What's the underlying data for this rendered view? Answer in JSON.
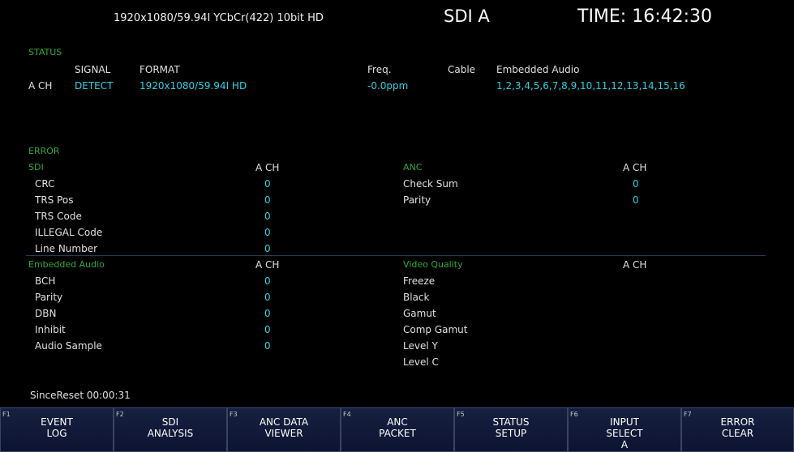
{
  "header": {
    "format": "1920x1080/59.94I YCbCr(422) 10bit HD",
    "input": "SDI A",
    "time": "TIME: 16:42:30"
  },
  "status": {
    "title": "STATUS",
    "col_signal": "SIGNAL",
    "col_format": "FORMAT",
    "col_freq": "Freq.",
    "col_cable": "Cable",
    "col_audio": "Embedded Audio",
    "row_label": "A CH",
    "signal": "DETECT",
    "format": "1920x1080/59.94I HD",
    "freq": "-0.0ppm",
    "audio": "1,2,3,4,5,6,7,8,9,10,11,12,13,14,15,16"
  },
  "error": {
    "title": "ERROR",
    "sdi": {
      "title": "SDI",
      "ch": "A CH",
      "rows": [
        {
          "label": "CRC",
          "value": "0"
        },
        {
          "label": "TRS Pos",
          "value": "0"
        },
        {
          "label": "TRS Code",
          "value": "0"
        },
        {
          "label": "ILLEGAL Code",
          "value": "0"
        },
        {
          "label": "Line Number",
          "value": "0"
        }
      ]
    },
    "anc": {
      "title": "ANC",
      "ch": "A CH",
      "rows": [
        {
          "label": "Check Sum",
          "value": "0"
        },
        {
          "label": "Parity",
          "value": "0"
        }
      ]
    },
    "audio": {
      "title": "Embedded Audio",
      "ch": "A CH",
      "rows": [
        {
          "label": "BCH",
          "value": "0"
        },
        {
          "label": "Parity",
          "value": "0"
        },
        {
          "label": "DBN",
          "value": "0"
        },
        {
          "label": "Inhibit",
          "value": "0"
        },
        {
          "label": "Audio Sample",
          "value": "0"
        }
      ]
    },
    "video": {
      "title": "Video Quality",
      "ch": "A CH",
      "rows": [
        {
          "label": "Freeze"
        },
        {
          "label": "Black"
        },
        {
          "label": "Gamut"
        },
        {
          "label": "Comp Gamut"
        },
        {
          "label": "Level Y"
        },
        {
          "label": "Level C"
        }
      ]
    }
  },
  "since_reset": "SinceReset 00:00:31",
  "fkeys": [
    {
      "num": "F1",
      "line1": "EVENT",
      "line2": "LOG",
      "line3": ""
    },
    {
      "num": "F2",
      "line1": "SDI",
      "line2": "ANALYSIS",
      "line3": ""
    },
    {
      "num": "F3",
      "line1": "ANC DATA",
      "line2": "VIEWER",
      "line3": ""
    },
    {
      "num": "F4",
      "line1": "ANC",
      "line2": "PACKET",
      "line3": ""
    },
    {
      "num": "F5",
      "line1": "STATUS",
      "line2": "SETUP",
      "line3": ""
    },
    {
      "num": "F6",
      "line1": "INPUT",
      "line2": "SELECT",
      "line3": "A"
    },
    {
      "num": "F7",
      "line1": "ERROR",
      "line2": "CLEAR",
      "line3": ""
    }
  ],
  "colors": {
    "section_title": "#2ea83a",
    "value": "#2fd0e0",
    "fkey_bg": "#0d1432"
  }
}
